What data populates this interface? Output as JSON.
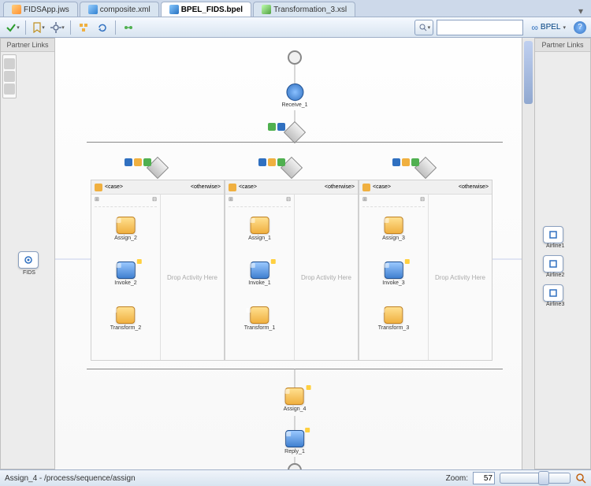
{
  "tabs": [
    {
      "label": "FIDSApp.jws",
      "icon": "jws"
    },
    {
      "label": "composite.xml",
      "icon": "xml"
    },
    {
      "label": "BPEL_FIDS.bpel",
      "icon": "bpel",
      "active": true
    },
    {
      "label": "Transformation_3.xsl",
      "icon": "xsl"
    }
  ],
  "toolbar": {
    "bpel_label": "BPEL",
    "search_placeholder": ""
  },
  "partner_links": {
    "left_header": "Partner Links",
    "right_header": "Partner Links",
    "left": [
      {
        "name": "FIDS"
      }
    ],
    "right": [
      {
        "name": "Airline1"
      },
      {
        "name": "Airline2"
      },
      {
        "name": "Airline3"
      }
    ]
  },
  "process": {
    "receive": {
      "label": "Receive_1"
    },
    "drop_text": "Drop Activity Here",
    "branches": [
      {
        "tabs": [
          "<case>",
          "<otherwise>"
        ],
        "activities": [
          {
            "type": "assign",
            "label": "Assign_2"
          },
          {
            "type": "invoke",
            "label": "Invoke_2"
          },
          {
            "type": "transform",
            "label": "Transform_2"
          }
        ]
      },
      {
        "tabs": [
          "<case>",
          "<otherwise>"
        ],
        "activities": [
          {
            "type": "assign",
            "label": "Assign_1"
          },
          {
            "type": "invoke",
            "label": "Invoke_1"
          },
          {
            "type": "transform",
            "label": "Transform_1"
          }
        ]
      },
      {
        "tabs": [
          "<case>",
          "<otherwise>"
        ],
        "activities": [
          {
            "type": "assign",
            "label": "Assign_3"
          },
          {
            "type": "invoke",
            "label": "Invoke_3"
          },
          {
            "type": "transform",
            "label": "Transform_3"
          }
        ]
      }
    ],
    "tail": [
      {
        "type": "assign",
        "label": "Assign_4"
      },
      {
        "type": "reply",
        "label": "Reply_1"
      }
    ]
  },
  "status": {
    "path": "Assign_4 - /process/sequence/assign",
    "zoom_label": "Zoom:",
    "zoom_value": "57"
  }
}
